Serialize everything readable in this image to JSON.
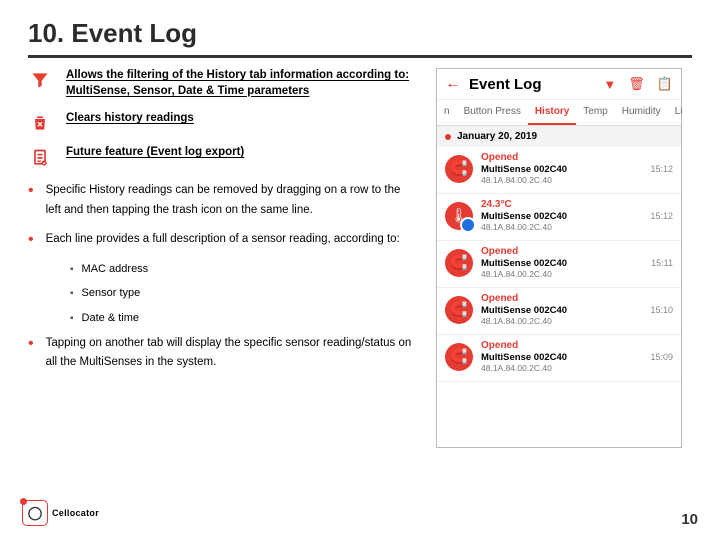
{
  "slide": {
    "title": "10. Event Log",
    "page_number": "10"
  },
  "icons": [
    {
      "name": "filter-icon",
      "text": "Allows the filtering of the History tab information according to: MultiSense, Sensor, Date & Time parameters"
    },
    {
      "name": "clear-icon",
      "text": "Clears history readings"
    },
    {
      "name": "export-icon",
      "text": "Future feature (Event log export)"
    }
  ],
  "bullets": [
    "Specific History readings can be removed by dragging on a row to the left and then tapping the trash icon on the same line.",
    "Each line provides a full description of a sensor reading, according to:",
    "Tapping on another tab will display the specific sensor reading/status on all the MultiSenses in the system."
  ],
  "subbullets": [
    "MAC address",
    "Sensor type",
    "Date & time"
  ],
  "phone": {
    "title": "Event Log",
    "tabs": [
      "n",
      "Button Press",
      "History",
      "Temp",
      "Humidity",
      "Li"
    ],
    "active_tab": "History",
    "date": "January 20, 2019",
    "device_name": "MultiSense 002C40",
    "mac": "48.1A.84.00.2C.40",
    "events": [
      {
        "status": "Opened",
        "time": "15:12",
        "type": "magnet"
      },
      {
        "status": "24.3°C",
        "time": "15:12",
        "type": "temp"
      },
      {
        "status": "Opened",
        "time": "15:11",
        "type": "magnet"
      },
      {
        "status": "Opened",
        "time": "15:10",
        "type": "magnet"
      },
      {
        "status": "Opened",
        "time": "15:09",
        "type": "magnet"
      }
    ]
  },
  "brand": "Cellocator"
}
